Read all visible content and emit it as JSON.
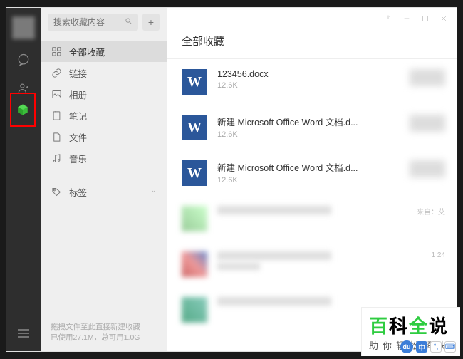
{
  "search": {
    "placeholder": "搜索收藏内容"
  },
  "categories": [
    {
      "key": "all",
      "label": "全部收藏",
      "active": true
    },
    {
      "key": "link",
      "label": "链接",
      "active": false
    },
    {
      "key": "album",
      "label": "相册",
      "active": false
    },
    {
      "key": "note",
      "label": "笔记",
      "active": false
    },
    {
      "key": "file",
      "label": "文件",
      "active": false
    },
    {
      "key": "music",
      "label": "音乐",
      "active": false
    }
  ],
  "tag": {
    "label": "标签"
  },
  "footer": {
    "line1": "拖拽文件至此直接新建收藏",
    "line2": "已使用27.1M，总可用1.0G"
  },
  "main": {
    "title": "全部收藏"
  },
  "items": [
    {
      "type": "word",
      "name": "123456.docx",
      "size": "12.6K"
    },
    {
      "type": "word",
      "name": "新建 Microsoft Office Word 文档.d...",
      "size": "12.6K"
    },
    {
      "type": "word",
      "name": "新建 Microsoft Office Word 文档.d...",
      "size": "12.6K"
    },
    {
      "type": "image",
      "meta": "来自：艾"
    },
    {
      "type": "image",
      "meta": "1     24"
    },
    {
      "type": "image",
      "meta": ""
    }
  ],
  "word_glyph": "W",
  "watermark": {
    "t1": "百",
    "t2": "科",
    "t3": "全",
    "t4": "说",
    "sub": "助你轻松解决"
  },
  "badges": {
    "du": "du",
    "cn": "中",
    "sym": "°,",
    "kb": "⌨"
  }
}
